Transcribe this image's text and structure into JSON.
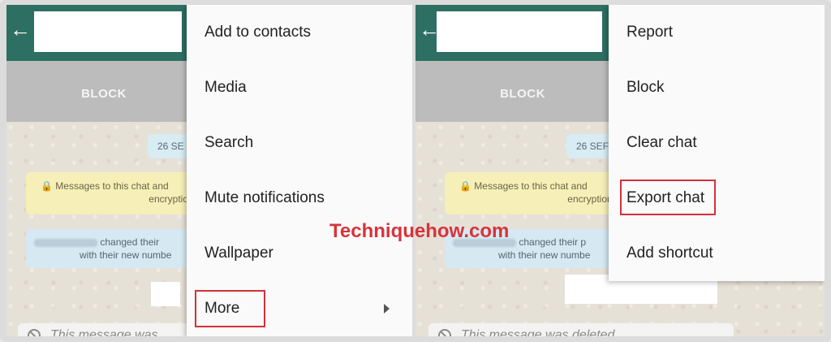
{
  "left": {
    "back_icon": "back-arrow-icon",
    "block_label": "BLOCK",
    "date_chip": "26 SE",
    "encryption": {
      "line1": "🔒 Messages to this chat and",
      "line2": "encryption."
    },
    "system_message": {
      "line1": "changed their",
      "line2": "with their new numbe"
    },
    "deleted_message": "This message was ...",
    "menu_items": [
      "Add to contacts",
      "Media",
      "Search",
      "Mute notifications",
      "Wallpaper",
      "More"
    ],
    "highlighted": "More"
  },
  "right": {
    "back_icon": "back-arrow-icon",
    "block_label": "BLOCK",
    "date_chip": "26 SEF",
    "encryption": {
      "line1": "🔒 Messages to this chat and",
      "line2": "encryption."
    },
    "system_message": {
      "line1": "changed their p",
      "line2": "with their new numbe"
    },
    "deleted_message": "This message was deleted",
    "menu_items": [
      "Report",
      "Block",
      "Clear chat",
      "Export chat",
      "Add shortcut"
    ],
    "highlighted": "Export chat"
  },
  "watermark": "Techniquehow.com",
  "colors": {
    "header": "#2d6f62",
    "highlight": "#d3313a",
    "watermark": "#d8333a"
  }
}
